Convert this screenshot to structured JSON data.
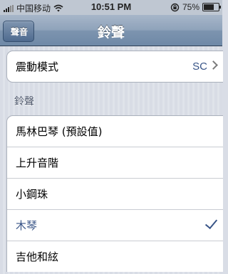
{
  "status_bar": {
    "carrier": "中国移动",
    "time": "10:51 PM",
    "battery": "75%",
    "battery_level": 0.75
  },
  "nav": {
    "back_label": "聲音",
    "title": "鈴聲"
  },
  "vibration_row": {
    "label": "震動模式",
    "value": "SC"
  },
  "ringtones": {
    "header": "鈴聲",
    "items": [
      {
        "label": "馬林巴琴 (預設值)",
        "selected": false
      },
      {
        "label": "上升音階",
        "selected": false
      },
      {
        "label": "小鋼珠",
        "selected": false
      },
      {
        "label": "木琴",
        "selected": true
      },
      {
        "label": "吉他和絃",
        "selected": false
      }
    ]
  }
}
